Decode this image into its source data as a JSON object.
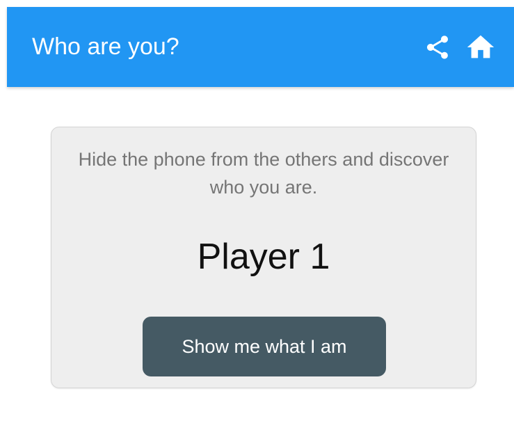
{
  "appbar": {
    "title": "Who are you?",
    "background_color": "#2196f3",
    "actions": [
      {
        "icon": "share-icon"
      },
      {
        "icon": "home-icon"
      }
    ]
  },
  "card": {
    "description": "Hide the phone from the others and discover who you are.",
    "player": "Player 1",
    "button_label": "Show me what I am",
    "button_color": "#455a64"
  }
}
